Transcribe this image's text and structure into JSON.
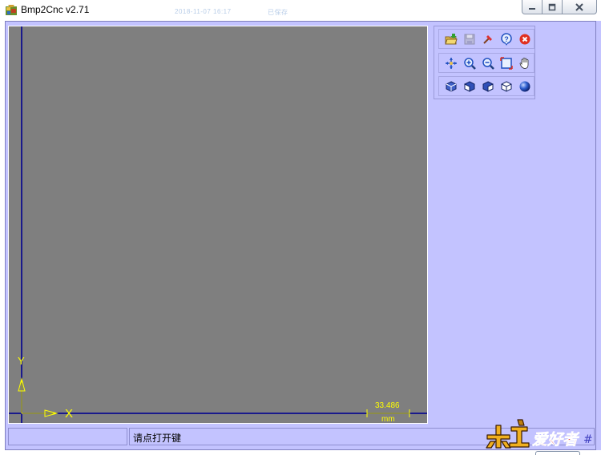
{
  "window": {
    "title": "Bmp2Cnc v2.71",
    "ghost_left": "2018-11-07 16:17",
    "ghost_right": "已保存"
  },
  "colors": {
    "client_bg": "#c3c3ff",
    "canvas_bg": "#7f7f7f",
    "axis_line": "#1a1a8c",
    "axis_label": "#ffff00"
  },
  "canvas": {
    "x_axis_label": "X",
    "y_axis_label": "Y",
    "scale_value": "33.486",
    "scale_unit": "mm"
  },
  "toolbar": {
    "rows": [
      [
        "open-file-icon",
        "save-icon",
        "tool-icon",
        "help-icon",
        "exit-icon"
      ],
      [
        "pan-center-icon",
        "zoom-in-icon",
        "zoom-out-icon",
        "zoom-fit-icon",
        "hand-pan-icon"
      ],
      [
        "view-iso-icon",
        "view-front-icon",
        "view-side-icon",
        "view-wireframe-icon",
        "view-shaded-icon"
      ]
    ]
  },
  "status": {
    "left": "",
    "message": "请点打开键"
  },
  "watermark": {
    "text": "木工爱好者"
  }
}
